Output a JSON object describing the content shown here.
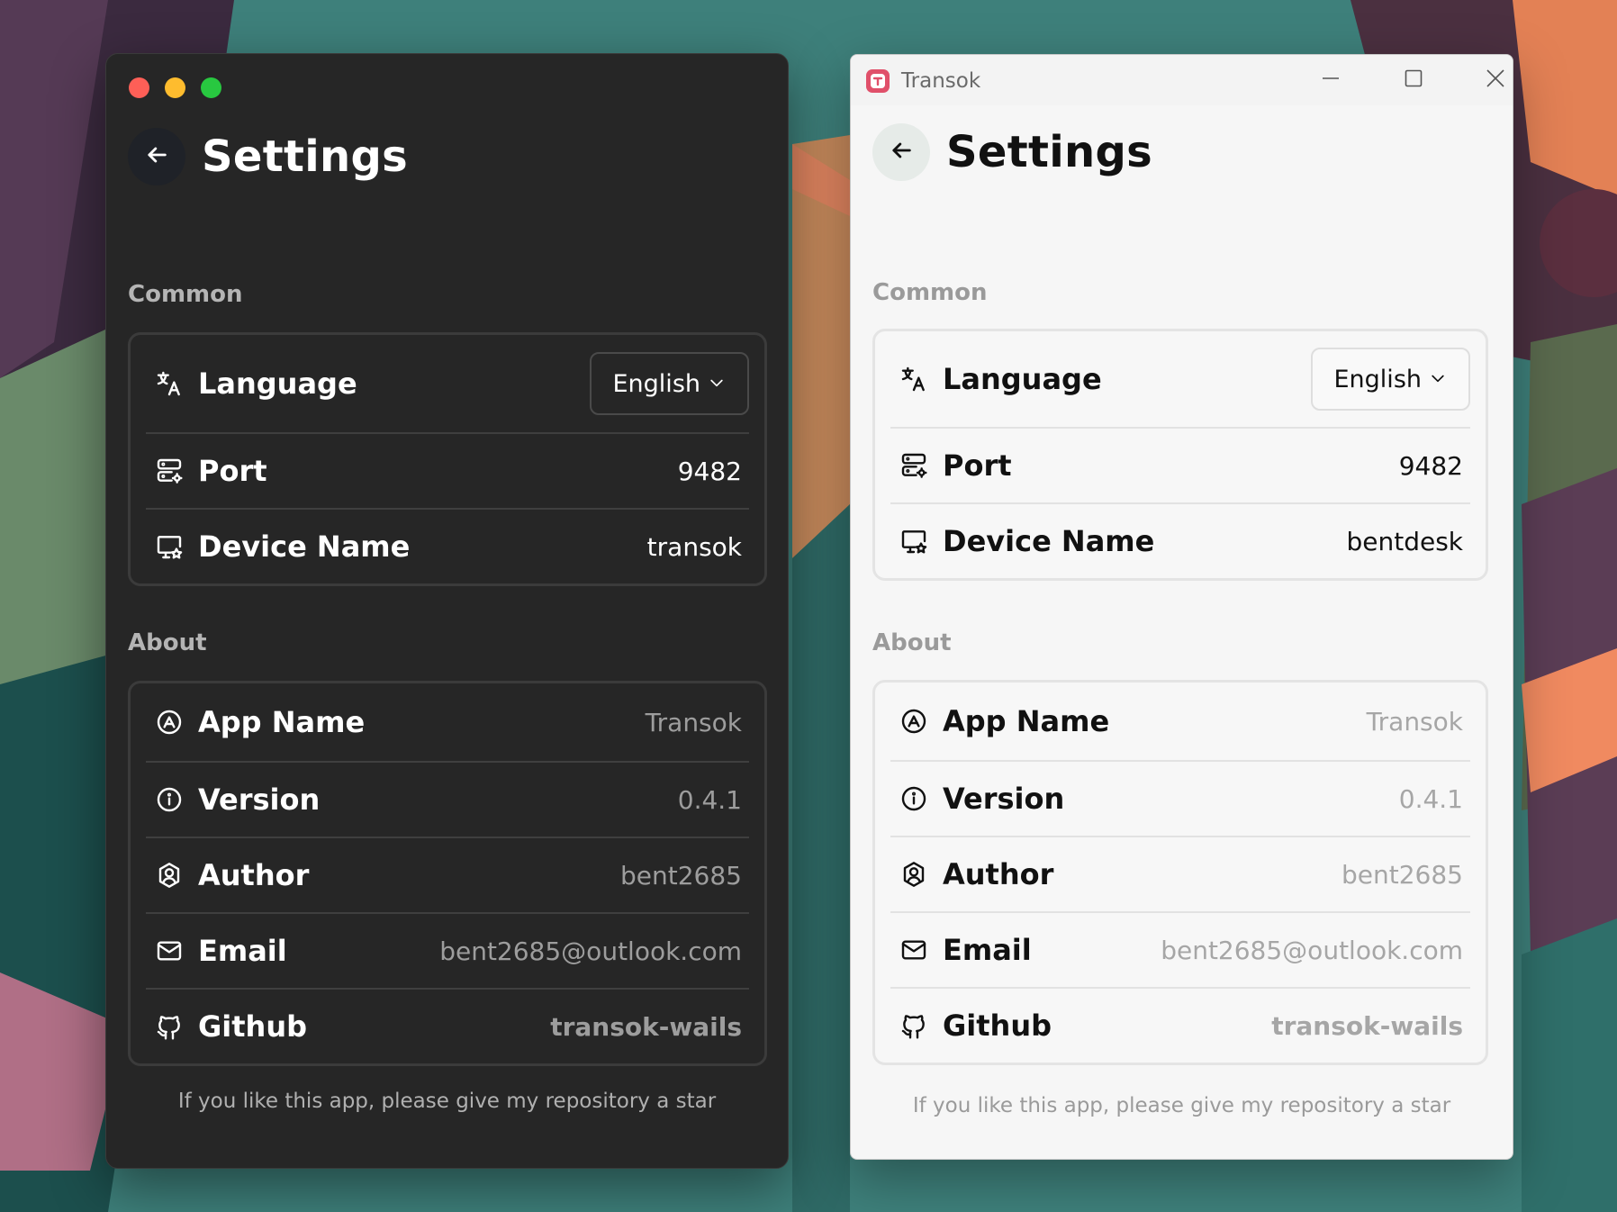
{
  "dark_window": {
    "page_title": "Settings",
    "common_label": "Common",
    "language": {
      "label": "Language",
      "value": "English"
    },
    "port": {
      "label": "Port",
      "value": "9482"
    },
    "device_name": {
      "label": "Device Name",
      "value": "transok"
    },
    "about_label": "About",
    "app_name": {
      "label": "App Name",
      "value": "Transok"
    },
    "version": {
      "label": "Version",
      "value": "0.4.1"
    },
    "author": {
      "label": "Author",
      "value": "bent2685"
    },
    "email": {
      "label": "Email",
      "value": "bent2685@outlook.com"
    },
    "github": {
      "label": "Github",
      "value": "transok-wails"
    },
    "footer_note": "If you like this app, please give my repository a star"
  },
  "light_window": {
    "window_title": "Transok",
    "page_title": "Settings",
    "common_label": "Common",
    "language": {
      "label": "Language",
      "value": "English"
    },
    "port": {
      "label": "Port",
      "value": "9482"
    },
    "device_name": {
      "label": "Device Name",
      "value": "bentdesk"
    },
    "about_label": "About",
    "app_name": {
      "label": "App Name",
      "value": "Transok"
    },
    "version": {
      "label": "Version",
      "value": "0.4.1"
    },
    "author": {
      "label": "Author",
      "value": "bent2685"
    },
    "email": {
      "label": "Email",
      "value": "bent2685@outlook.com"
    },
    "github": {
      "label": "Github",
      "value": "transok-wails"
    },
    "footer_note": "If you like this app, please give my repository a star"
  }
}
